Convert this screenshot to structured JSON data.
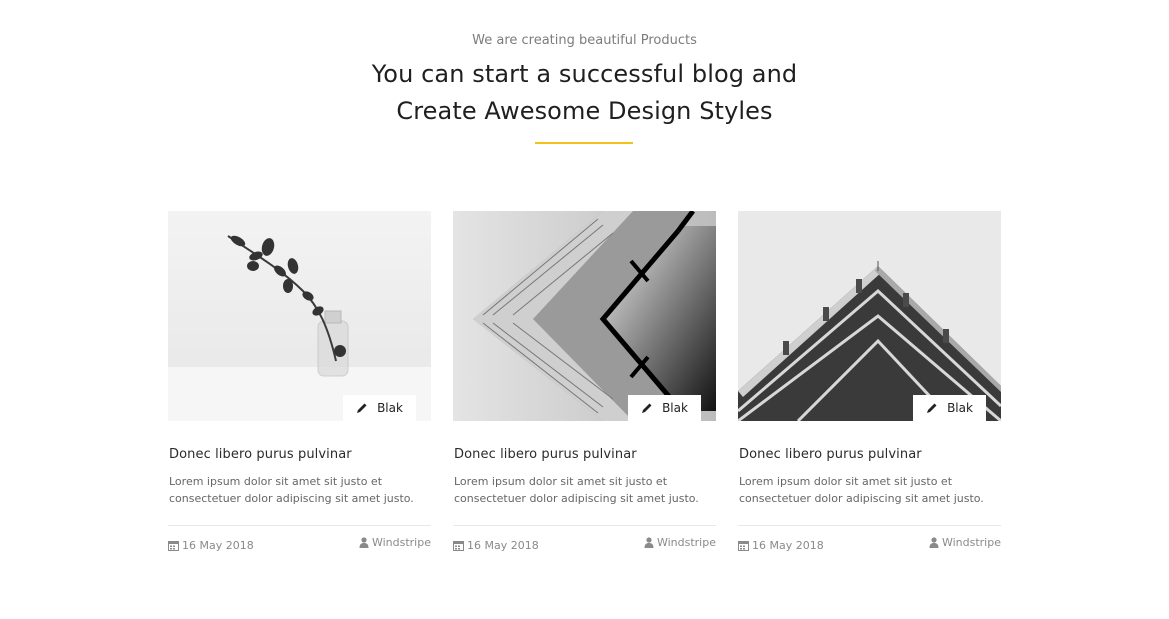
{
  "header": {
    "subtitle": "We are creating beautiful Products",
    "title_line1": "You can start a successful blog and",
    "title_line2": "Create Awesome Design Styles",
    "accent_color": "#f2c21b"
  },
  "posts": [
    {
      "image": "plant-in-glass-bottle",
      "tag": "Blak",
      "tag_icon": "pencil-icon",
      "title": "Donec libero purus pulvinar",
      "excerpt": "Lorem ipsum dolor sit amet sit justo et consectetuer dolor adipiscing sit amet justo.",
      "date": "16 May 2018",
      "date_icon": "calendar-icon",
      "author": "Windstripe",
      "author_icon": "user-icon"
    },
    {
      "image": "building-facade-perspective",
      "tag": "Blak",
      "tag_icon": "pencil-icon",
      "title": "Donec libero purus pulvinar",
      "excerpt": "Lorem ipsum dolor sit amet sit justo et consectetuer dolor adipiscing sit amet justo.",
      "date": "16 May 2018",
      "date_icon": "calendar-icon",
      "author": "Windstripe",
      "author_icon": "user-icon"
    },
    {
      "image": "building-corner-balconies",
      "tag": "Blak",
      "tag_icon": "pencil-icon",
      "title": "Donec libero purus pulvinar",
      "excerpt": "Lorem ipsum dolor sit amet sit justo et consectetuer dolor adipiscing sit amet justo.",
      "date": "16 May 2018",
      "date_icon": "calendar-icon",
      "author": "Windstripe",
      "author_icon": "user-icon"
    }
  ]
}
